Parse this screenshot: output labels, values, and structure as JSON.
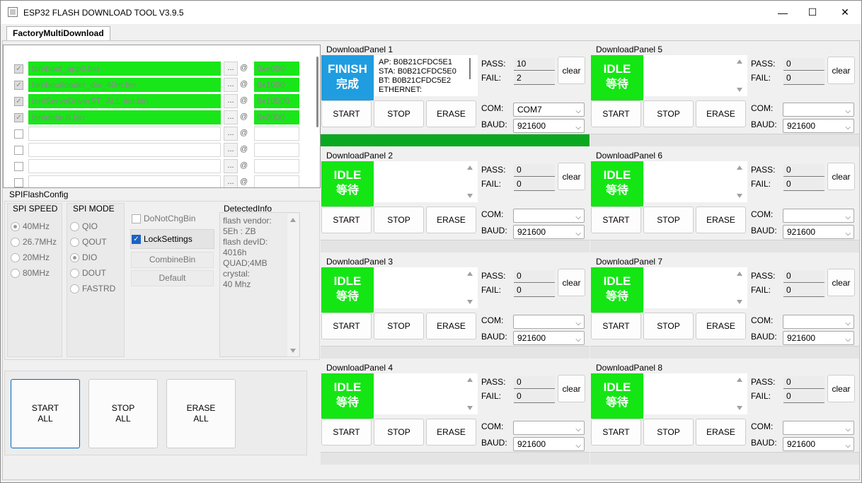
{
  "window": {
    "title": "ESP32 FLASH DOWNLOAD TOOL V3.9.5",
    "minimize": "—",
    "maximize": "☐",
    "close": "✕"
  },
  "tabs": [
    {
      "label": "FactoryMultiDownload"
    }
  ],
  "files": [
    {
      "checked": true,
      "path": "bin\\boot_app0.bin",
      "addr": "0xe000"
    },
    {
      "checked": true,
      "path": "bin\\bootloader_dio_40m.bin",
      "addr": "0x1000"
    },
    {
      "checked": true,
      "path": "bin\\ServoDriverST_ALL.ino.bin",
      "addr": "0x10000"
    },
    {
      "checked": true,
      "path": "bin\\default.bin",
      "addr": "0x8000"
    },
    {
      "checked": false,
      "path": "",
      "addr": ""
    },
    {
      "checked": false,
      "path": "",
      "addr": ""
    },
    {
      "checked": false,
      "path": "",
      "addr": ""
    },
    {
      "checked": false,
      "path": "",
      "addr": ""
    }
  ],
  "file_browse_label": "...",
  "file_at_label": "@",
  "spi": {
    "title": "SPIFlashConfig",
    "speed_title": "SPI SPEED",
    "speeds": [
      {
        "label": "40MHz",
        "selected": true
      },
      {
        "label": "26.7MHz",
        "selected": false
      },
      {
        "label": "20MHz",
        "selected": false
      },
      {
        "label": "80MHz",
        "selected": false
      }
    ],
    "mode_title": "SPI MODE",
    "modes": [
      {
        "label": "QIO",
        "selected": false
      },
      {
        "label": "QOUT",
        "selected": false
      },
      {
        "label": "DIO",
        "selected": true
      },
      {
        "label": "DOUT",
        "selected": false
      },
      {
        "label": "FASTRD",
        "selected": false
      }
    ],
    "do_not_chg_bin": {
      "label": "DoNotChgBin",
      "checked": false
    },
    "lock_settings": {
      "label": "LockSettings",
      "checked": true
    },
    "combine_bin": "CombineBin",
    "default": "Default",
    "detected_title": "DetectedInfo",
    "detected_lines": [
      "flash vendor:",
      "5Eh : ZB",
      "flash devID:",
      "4016h",
      "QUAD;4MB",
      "crystal:",
      "40 Mhz"
    ]
  },
  "big_buttons": {
    "start": "START\nALL",
    "stop": "STOP\nALL",
    "erase": "ERASE\nALL"
  },
  "panel_labels": {
    "pass": "PASS:",
    "fail": "FAIL:",
    "com": "COM:",
    "baud": "BAUD:",
    "clear": "clear",
    "start": "START",
    "stop": "STOP",
    "erase": "ERASE"
  },
  "panels": [
    {
      "title": "DownloadPanel 1",
      "state_en": "FINISH",
      "state_cn": "完成",
      "finish": true,
      "info": [
        "AP:  B0B21CFDC5E1",
        "STA:  B0B21CFDC5E0",
        "BT:  B0B21CFDC5E2",
        "ETHERNET:"
      ],
      "pass": "10",
      "fail": "2",
      "com": "COM7",
      "baud": "921600",
      "progress": 1.0
    },
    {
      "title": "DownloadPanel 2",
      "state_en": "IDLE",
      "state_cn": "等待",
      "finish": false,
      "info": [],
      "pass": "0",
      "fail": "0",
      "com": "",
      "baud": "921600",
      "progress": 0
    },
    {
      "title": "DownloadPanel 3",
      "state_en": "IDLE",
      "state_cn": "等待",
      "finish": false,
      "info": [],
      "pass": "0",
      "fail": "0",
      "com": "",
      "baud": "921600",
      "progress": 0
    },
    {
      "title": "DownloadPanel 4",
      "state_en": "IDLE",
      "state_cn": "等待",
      "finish": false,
      "info": [],
      "pass": "0",
      "fail": "0",
      "com": "",
      "baud": "921600",
      "progress": 0
    },
    {
      "title": "DownloadPanel 5",
      "state_en": "IDLE",
      "state_cn": "等待",
      "finish": false,
      "info": [],
      "pass": "0",
      "fail": "0",
      "com": "",
      "baud": "921600",
      "progress": 0
    },
    {
      "title": "DownloadPanel 6",
      "state_en": "IDLE",
      "state_cn": "等待",
      "finish": false,
      "info": [],
      "pass": "0",
      "fail": "0",
      "com": "",
      "baud": "921600",
      "progress": 0
    },
    {
      "title": "DownloadPanel 7",
      "state_en": "IDLE",
      "state_cn": "等待",
      "finish": false,
      "info": [],
      "pass": "0",
      "fail": "0",
      "com": "",
      "baud": "921600",
      "progress": 0
    },
    {
      "title": "DownloadPanel 8",
      "state_en": "IDLE",
      "state_cn": "等待",
      "finish": false,
      "info": [],
      "pass": "0",
      "fail": "0",
      "com": "",
      "baud": "921600",
      "progress": 0
    }
  ]
}
